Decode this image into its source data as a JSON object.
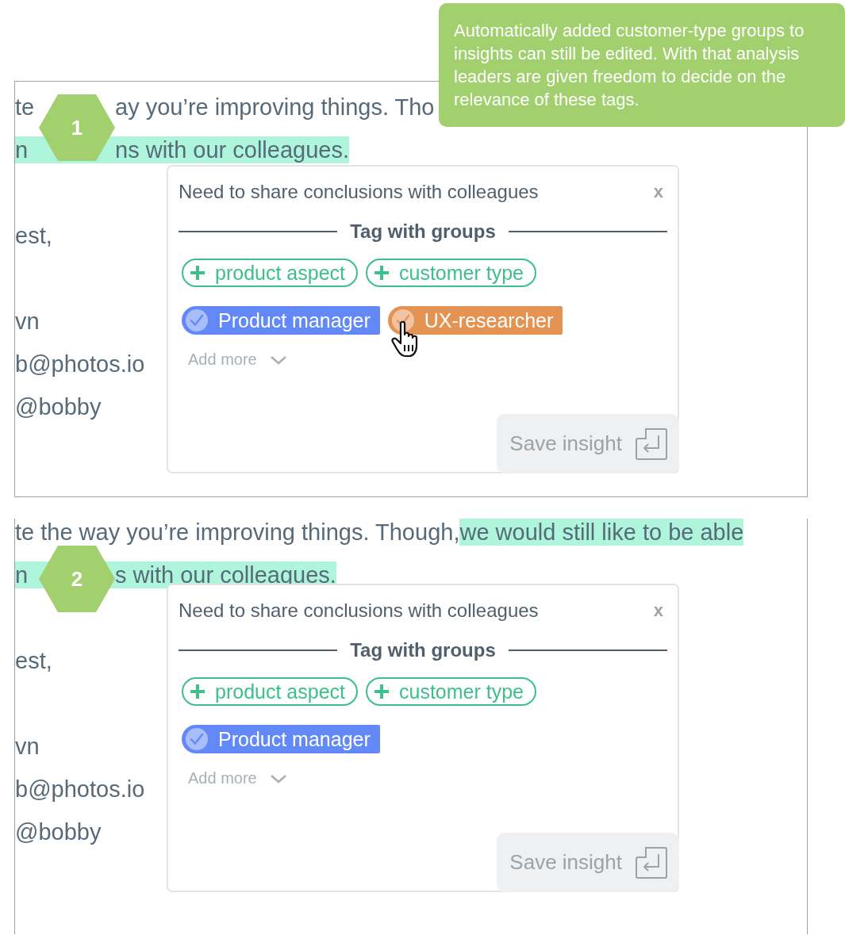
{
  "callout": {
    "text": "Automatically added customer-type groups to insights can still be edited. With that analysis leaders are given freedom to decide on the relevance of these tags."
  },
  "steps": [
    {
      "number": "1",
      "lines": [
        {
          "kind": "text",
          "segments": [
            {
              "text": "te",
              "highlighted": false
            }
          ],
          "segments_after_badge": [
            {
              "text": "ay you’re improving things. Tho",
              "highlighted": false
            }
          ]
        },
        {
          "kind": "text",
          "segments": [
            {
              "text": "n",
              "highlighted": true
            }
          ],
          "segments_after_badge": [
            {
              "text": "ns with our colleagues.",
              "highlighted": true
            }
          ]
        },
        {
          "kind": "blank"
        },
        {
          "kind": "text",
          "segments": [
            {
              "text": "est,",
              "highlighted": false
            }
          ]
        },
        {
          "kind": "blank"
        },
        {
          "kind": "text",
          "segments": [
            {
              "text": "vn",
              "highlighted": false
            }
          ]
        },
        {
          "kind": "text",
          "segments": [
            {
              "text": "b@photos.io",
              "highlighted": false
            }
          ]
        },
        {
          "kind": "text",
          "segments": [
            {
              "text": "@bobby",
              "highlighted": false
            }
          ]
        }
      ],
      "popup": {
        "title": "Need to share conclusions with colleagues",
        "close": "x",
        "heading": "Tag with groups",
        "add_tags": [
          {
            "label": "product aspect"
          },
          {
            "label": "customer type"
          }
        ],
        "group_tags": [
          {
            "label": "Product manager",
            "color": "#6388f7",
            "hovered": false
          },
          {
            "label": "UX-researcher",
            "color": "#e59352",
            "hovered": true
          }
        ],
        "add_more": "Add more",
        "save": "Save insight"
      }
    },
    {
      "number": "2",
      "lines": [
        {
          "kind": "text",
          "segments": [
            {
              "text": "te the way you’re improving things. Though, ",
              "highlighted": false
            },
            {
              "text": "we would still like to be able",
              "highlighted": true
            }
          ]
        },
        {
          "kind": "text",
          "segments": [
            {
              "text": "n",
              "highlighted": true
            }
          ],
          "segments_after_badge": [
            {
              "text": "s with our colleagues.",
              "highlighted": true
            }
          ]
        },
        {
          "kind": "blank"
        },
        {
          "kind": "text",
          "segments": [
            {
              "text": "est,",
              "highlighted": false
            }
          ]
        },
        {
          "kind": "blank"
        },
        {
          "kind": "text",
          "segments": [
            {
              "text": "vn",
              "highlighted": false
            }
          ]
        },
        {
          "kind": "text",
          "segments": [
            {
              "text": "b@photos.io",
              "highlighted": false
            }
          ]
        },
        {
          "kind": "text",
          "segments": [
            {
              "text": "@bobby",
              "highlighted": false
            }
          ]
        }
      ],
      "popup": {
        "title": "Need to share conclusions with colleagues",
        "close": "x",
        "heading": "Tag with groups",
        "add_tags": [
          {
            "label": "product aspect"
          },
          {
            "label": "customer type"
          }
        ],
        "group_tags": [
          {
            "label": "Product manager",
            "color": "#6388f7",
            "hovered": false
          }
        ],
        "add_more": "Add more",
        "save": "Save insight"
      }
    }
  ]
}
